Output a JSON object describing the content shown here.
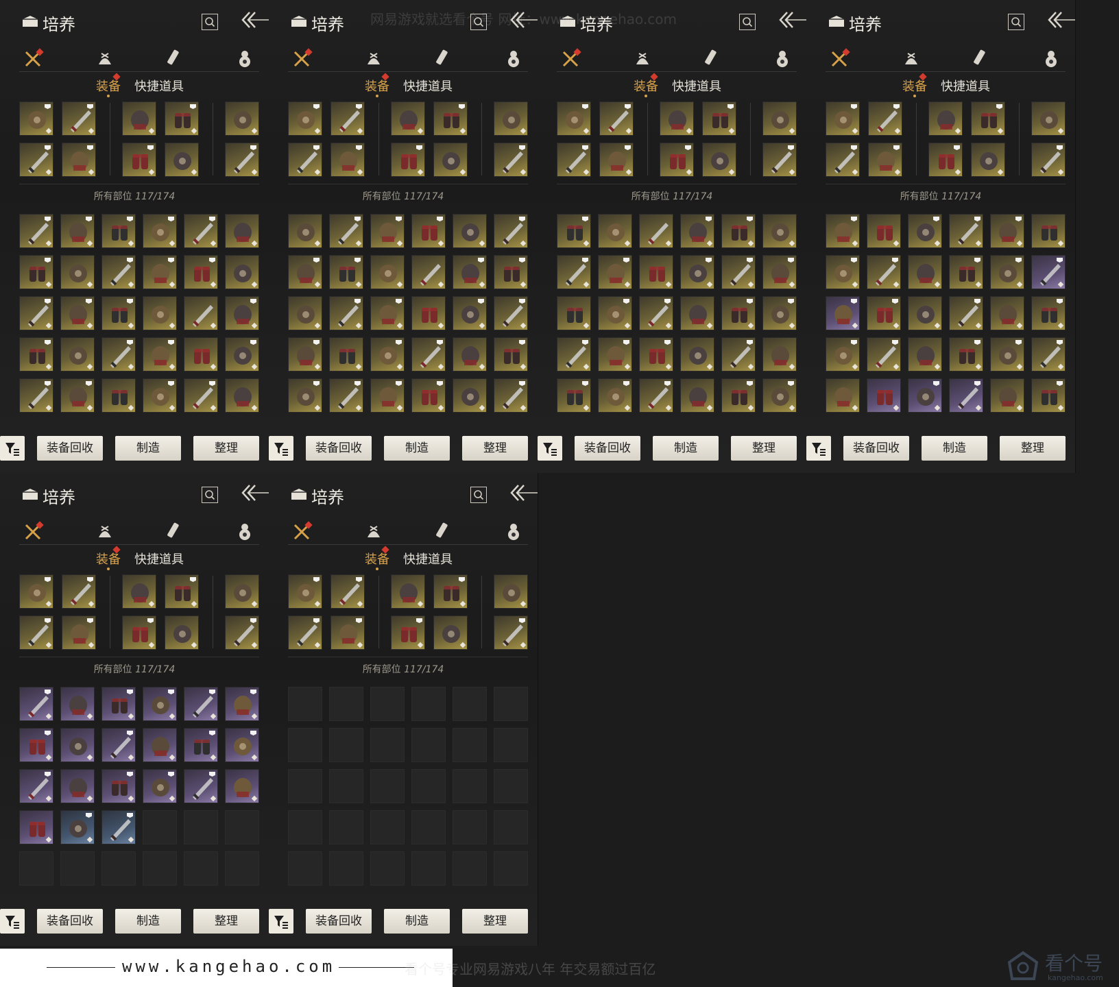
{
  "header": {
    "title": "培养"
  },
  "subtabs": {
    "equip": "装备",
    "quick": "快捷道具"
  },
  "count_label": "所有部位",
  "count_value": "117/174",
  "buttons": {
    "recycle": "装备回收",
    "craft": "制造",
    "sort": "整理"
  },
  "watermark_top": "网易游戏就选看个号  网址：www.kangehao.com",
  "footer": {
    "url": "www.kangehao.com",
    "slogan": "看个号专业网易游戏八年  年交易额过百亿"
  },
  "logo": {
    "name": "看个号",
    "sub": "kangehao.com"
  },
  "icons": [
    "box-icon",
    "search-icon",
    "back-arrow-icon",
    "weapon-tab-icon",
    "pouch-tab-icon",
    "scroll-tab-icon",
    "gourd-tab-icon",
    "filter-icon",
    "equip-item-icon"
  ]
}
